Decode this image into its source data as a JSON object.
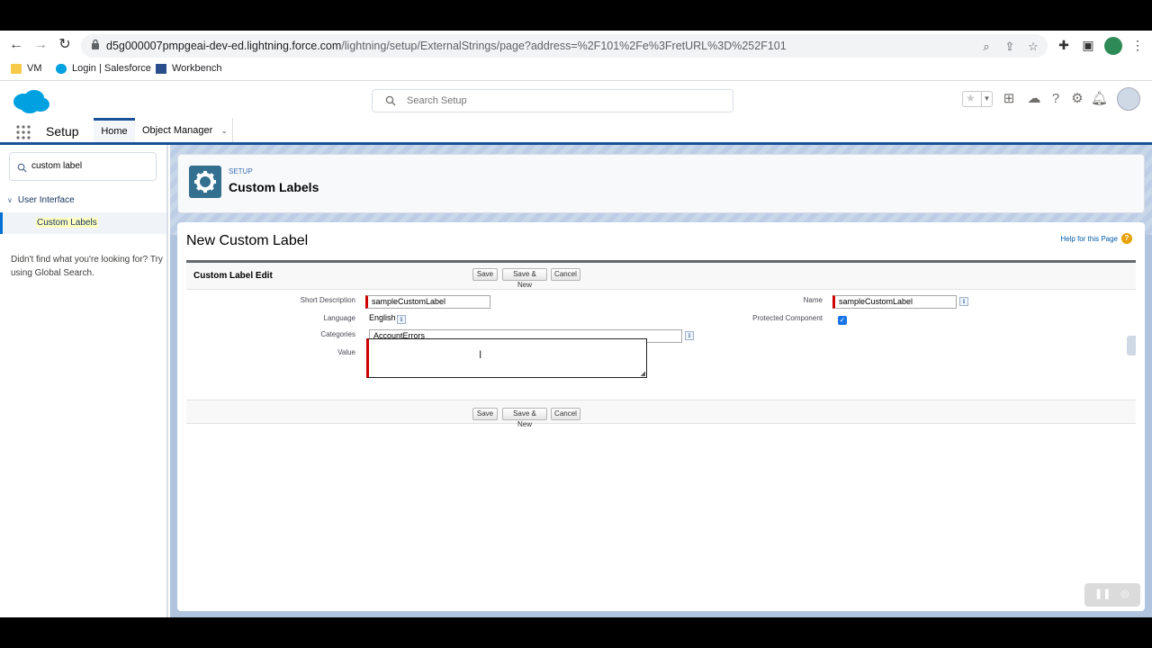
{
  "browser": {
    "url_host": "d5g000007pmpgeai-dev-ed.lightning.force.com",
    "url_path": "/lightning/setup/ExternalStrings/page?address=%2F101%2Fe%3FretURL%3D%252F101",
    "bookmarks": [
      "VM",
      "Login | Salesforce",
      "Workbench"
    ]
  },
  "header": {
    "search_placeholder": "Search Setup"
  },
  "nav": {
    "app_name": "Setup",
    "tabs": [
      "Home",
      "Object Manager"
    ]
  },
  "sidebar": {
    "quick_find_value": "custom label",
    "group": "User Interface",
    "item": "Custom Labels",
    "hint": "Didn't find what you're looking for? Try using Global Search."
  },
  "page_header": {
    "eyebrow": "SETUP",
    "title": "Custom Labels"
  },
  "form": {
    "title": "New Custom Label",
    "help_link": "Help for this Page",
    "block_title": "Custom Label Edit",
    "buttons": {
      "save": "Save",
      "save_new": "Save & New",
      "cancel": "Cancel"
    },
    "labels": {
      "short_description": "Short Description",
      "language": "Language",
      "categories": "Categories",
      "value": "Value",
      "name": "Name",
      "protected": "Protected Component"
    },
    "values": {
      "short_description": "sampleCustomLabel",
      "language": "English",
      "categories": "AccountErrors",
      "value": "",
      "name": "sampleCustomLabel",
      "protected": true
    }
  },
  "colors": {
    "brand": "#00a1e0",
    "nav_accent": "#1b5297",
    "required": "#cc0000"
  }
}
